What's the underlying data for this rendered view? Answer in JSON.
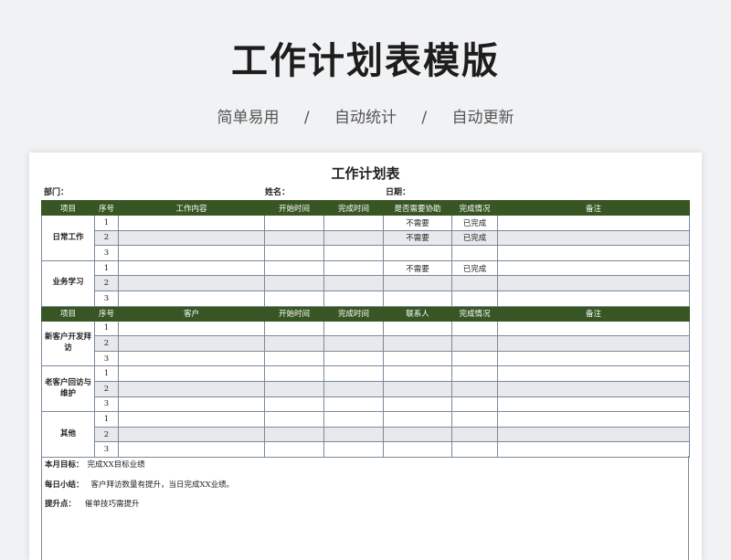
{
  "banner": {
    "title": "工作计划表模版",
    "features": [
      "简单易用",
      "/",
      "自动统计",
      "/",
      "自动更新"
    ]
  },
  "sheet": {
    "title": "工作计划表",
    "dept_label": "部门：",
    "name_label": "姓名：",
    "date_label": "日期：",
    "section1": {
      "headers": [
        "项目",
        "序号",
        "工作内容",
        "开始时间",
        "完成时间",
        "是否需要协助",
        "完成情况",
        "备注"
      ],
      "groups": [
        {
          "name": "日常工作",
          "rows": [
            {
              "no": "1",
              "assist": "不需要",
              "status": "已完成"
            },
            {
              "no": "2",
              "assist": "不需要",
              "status": "已完成"
            },
            {
              "no": "3",
              "assist": "",
              "status": ""
            }
          ]
        },
        {
          "name": "业务学习",
          "rows": [
            {
              "no": "1",
              "assist": "不需要",
              "status": "已完成"
            },
            {
              "no": "2",
              "assist": "",
              "status": ""
            },
            {
              "no": "3",
              "assist": "",
              "status": ""
            }
          ]
        }
      ]
    },
    "section2": {
      "headers": [
        "项目",
        "序号",
        "客户",
        "开始时间",
        "完成时间",
        "联系人",
        "完成情况",
        "备注"
      ],
      "groups": [
        {
          "name": "新客户开发拜访",
          "rows": [
            {
              "no": "1"
            },
            {
              "no": "2"
            },
            {
              "no": "3"
            }
          ]
        },
        {
          "name": "老客户回访与维护",
          "rows": [
            {
              "no": "1"
            },
            {
              "no": "2"
            },
            {
              "no": "3"
            }
          ]
        },
        {
          "name": "其他",
          "rows": [
            {
              "no": "1"
            },
            {
              "no": "2"
            },
            {
              "no": "3"
            }
          ]
        }
      ]
    },
    "notes": {
      "monthly_label": "本月目标：",
      "monthly_value": "完成XX目标业绩",
      "daily_label": "每日小结：",
      "daily_value": "客户拜访数量有提升，当日完成XX业绩。",
      "improve_label": "提升点：",
      "improve_value": "催单技巧需提升"
    },
    "colors": {
      "header_bg": "#375623",
      "alt_row": "#e7e9ec"
    }
  }
}
